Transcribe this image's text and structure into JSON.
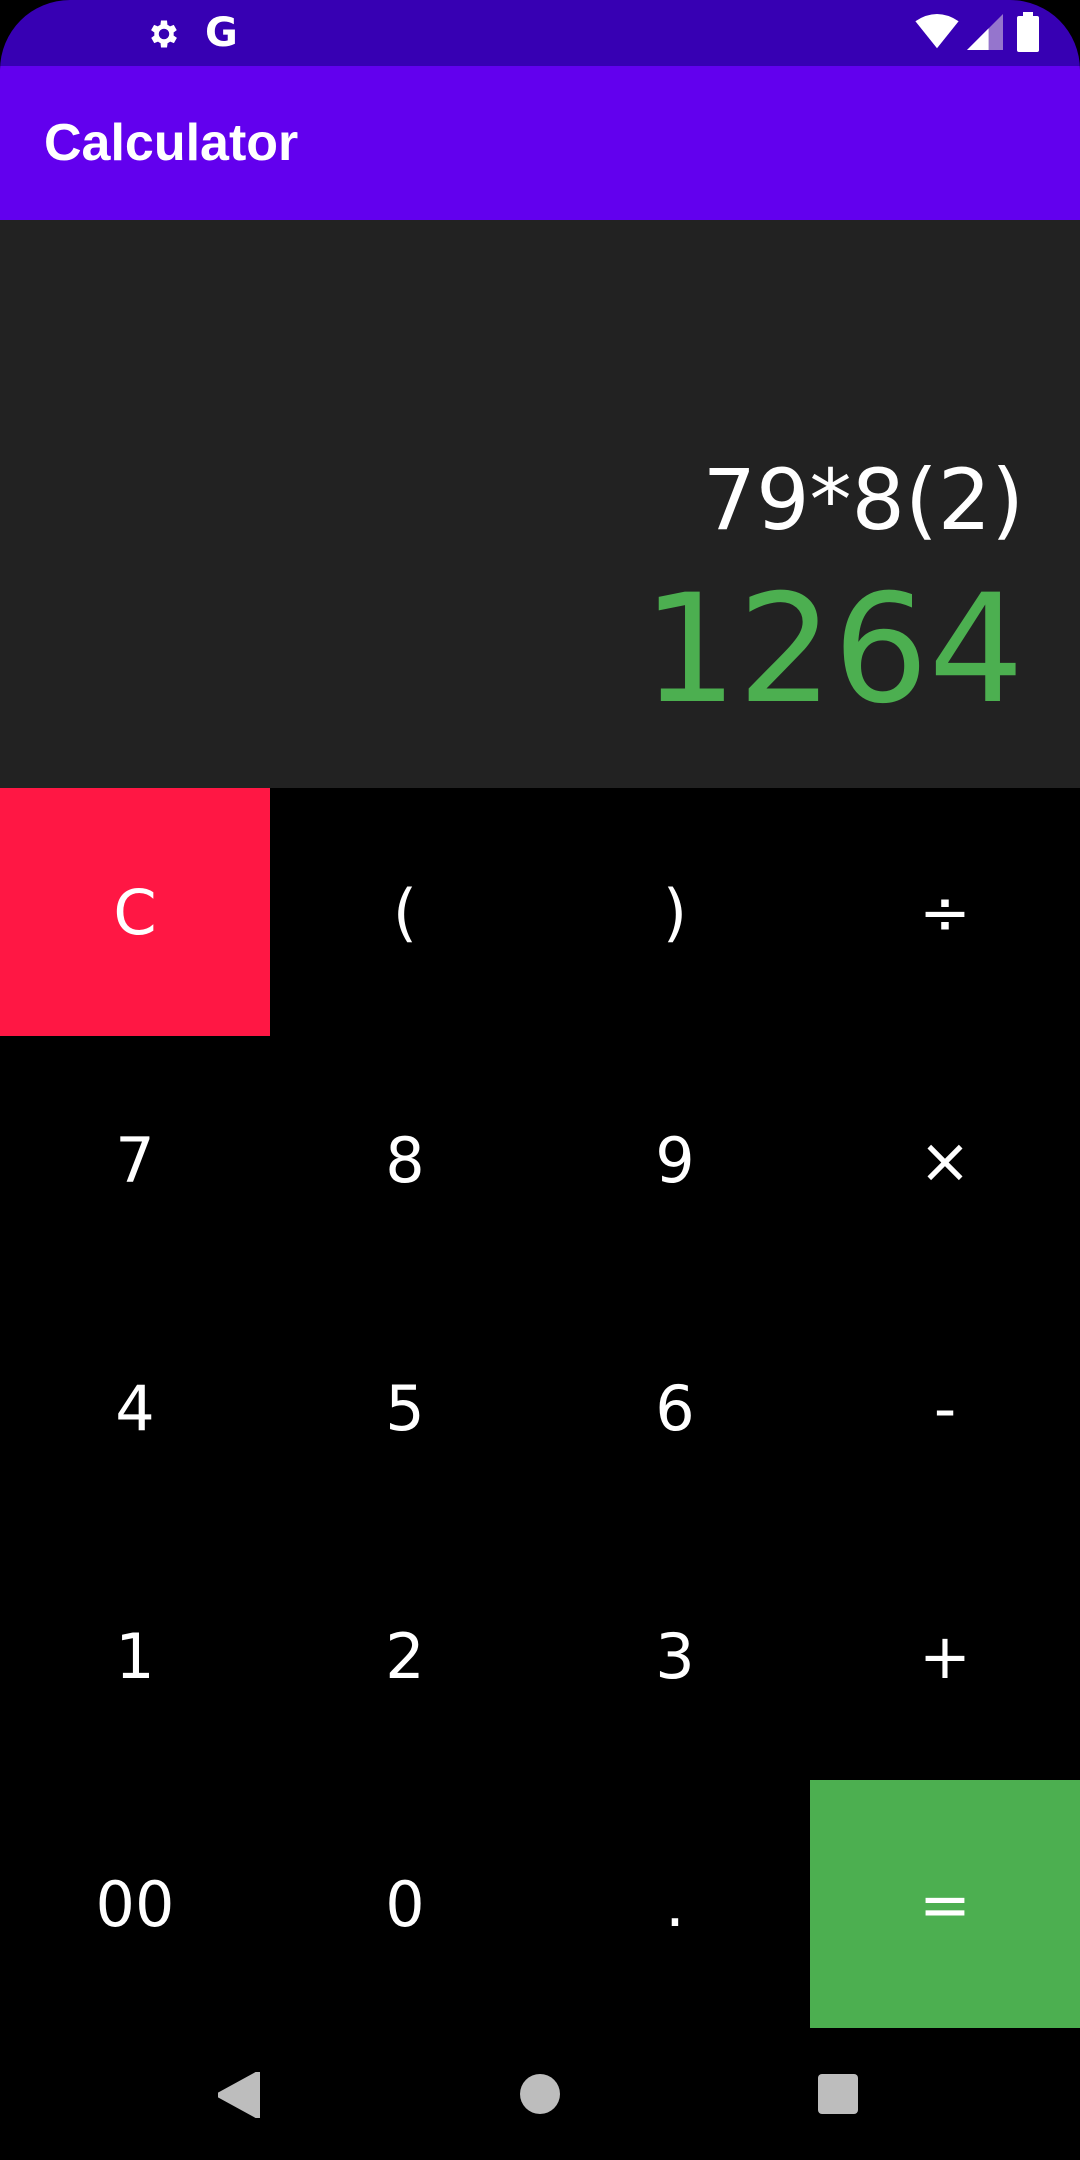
{
  "status_bar": {
    "icons": [
      "gear-icon",
      "google-g-icon",
      "wifi-icon",
      "signal-icon",
      "battery-icon"
    ],
    "google_label": "G",
    "background": "#3700B3"
  },
  "app_bar": {
    "title": "Calculator",
    "background": "#6200EE"
  },
  "display": {
    "expression": "79*8(2)",
    "result": "1264",
    "result_color": "#4CAF50",
    "background": "#222222"
  },
  "keypad": {
    "rows": [
      [
        "C",
        "(",
        ")",
        "÷"
      ],
      [
        "7",
        "8",
        "9",
        "×"
      ],
      [
        "4",
        "5",
        "6",
        "-"
      ],
      [
        "1",
        "2",
        "3",
        "+"
      ],
      [
        "00",
        "0",
        ".",
        "="
      ]
    ],
    "clear_color": "#FF1744",
    "equals_color": "#4CAF50"
  },
  "nav_bar": {
    "icons": [
      "back-icon",
      "home-icon",
      "recents-icon"
    ]
  }
}
